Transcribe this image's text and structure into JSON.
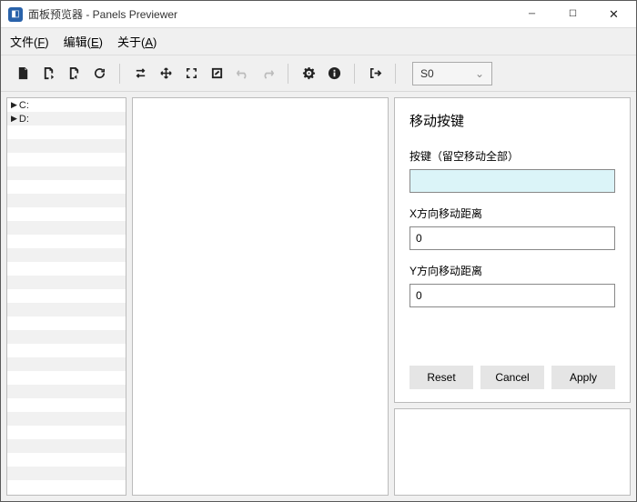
{
  "window": {
    "title": "面板预览器 - Panels Previewer"
  },
  "menu": {
    "file": "文件(F)",
    "edit": "编辑(E)",
    "about": "关于(A)"
  },
  "toolbar": {
    "combo_value": "S0"
  },
  "tree": {
    "items": [
      "C:",
      "D:"
    ]
  },
  "panel": {
    "title": "移动按键",
    "key_label": "按键（留空移动全部）",
    "key_value": "",
    "x_label": "X方向移动距离",
    "x_value": "0",
    "y_label": "Y方向移动距离",
    "y_value": "0",
    "reset": "Reset",
    "cancel": "Cancel",
    "apply": "Apply"
  }
}
